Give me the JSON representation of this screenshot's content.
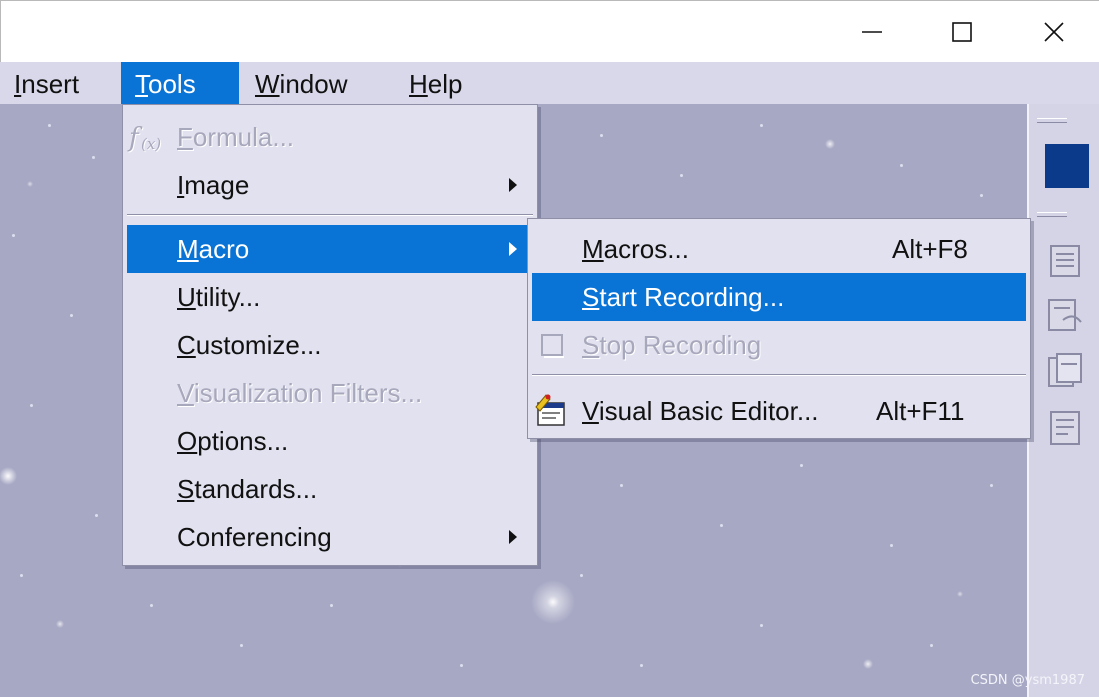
{
  "titlebar": {
    "buttons": [
      {
        "name": "minimize",
        "icon": "minimize-icon"
      },
      {
        "name": "maximize",
        "icon": "maximize-icon"
      },
      {
        "name": "close",
        "icon": "close-icon"
      }
    ]
  },
  "menubar": {
    "items": [
      {
        "label": "Insert",
        "mnemonic": "I"
      },
      {
        "label": "Tools",
        "mnemonic": "T",
        "active": true
      },
      {
        "label": "Window",
        "mnemonic": "W"
      },
      {
        "label": "Help",
        "mnemonic": "H"
      }
    ]
  },
  "tools_menu": {
    "items": [
      {
        "label": "Formula...",
        "disabled": true,
        "icon": "formula-fx-icon"
      },
      {
        "label": "Image",
        "submenu": true
      },
      {
        "label": "Macro",
        "submenu": true,
        "highlighted": true
      },
      {
        "label": "Utility..."
      },
      {
        "label": "Customize..."
      },
      {
        "label": "Visualization Filters...",
        "disabled": true
      },
      {
        "label": "Options..."
      },
      {
        "label": "Standards..."
      },
      {
        "label": "Conferencing",
        "submenu": true
      }
    ]
  },
  "macro_menu": {
    "items": [
      {
        "label": "Macros...",
        "shortcut": "Alt+F8"
      },
      {
        "label": "Start Recording...",
        "highlighted": true
      },
      {
        "label": "Stop Recording",
        "disabled": true,
        "icon": "stop-square-icon"
      },
      {
        "label": "Visual Basic Editor...",
        "shortcut": "Alt+F11",
        "icon": "vb-editor-icon"
      }
    ]
  },
  "colors": {
    "highlight": "#0a74d6",
    "menu_bg": "#e1e1ef",
    "menubar_bg": "#d8d8ea",
    "workspace_bg": "#a7a8c4",
    "toolbar_swatch": "#0b3a8a"
  },
  "watermark": "CSDN @ysm1987"
}
